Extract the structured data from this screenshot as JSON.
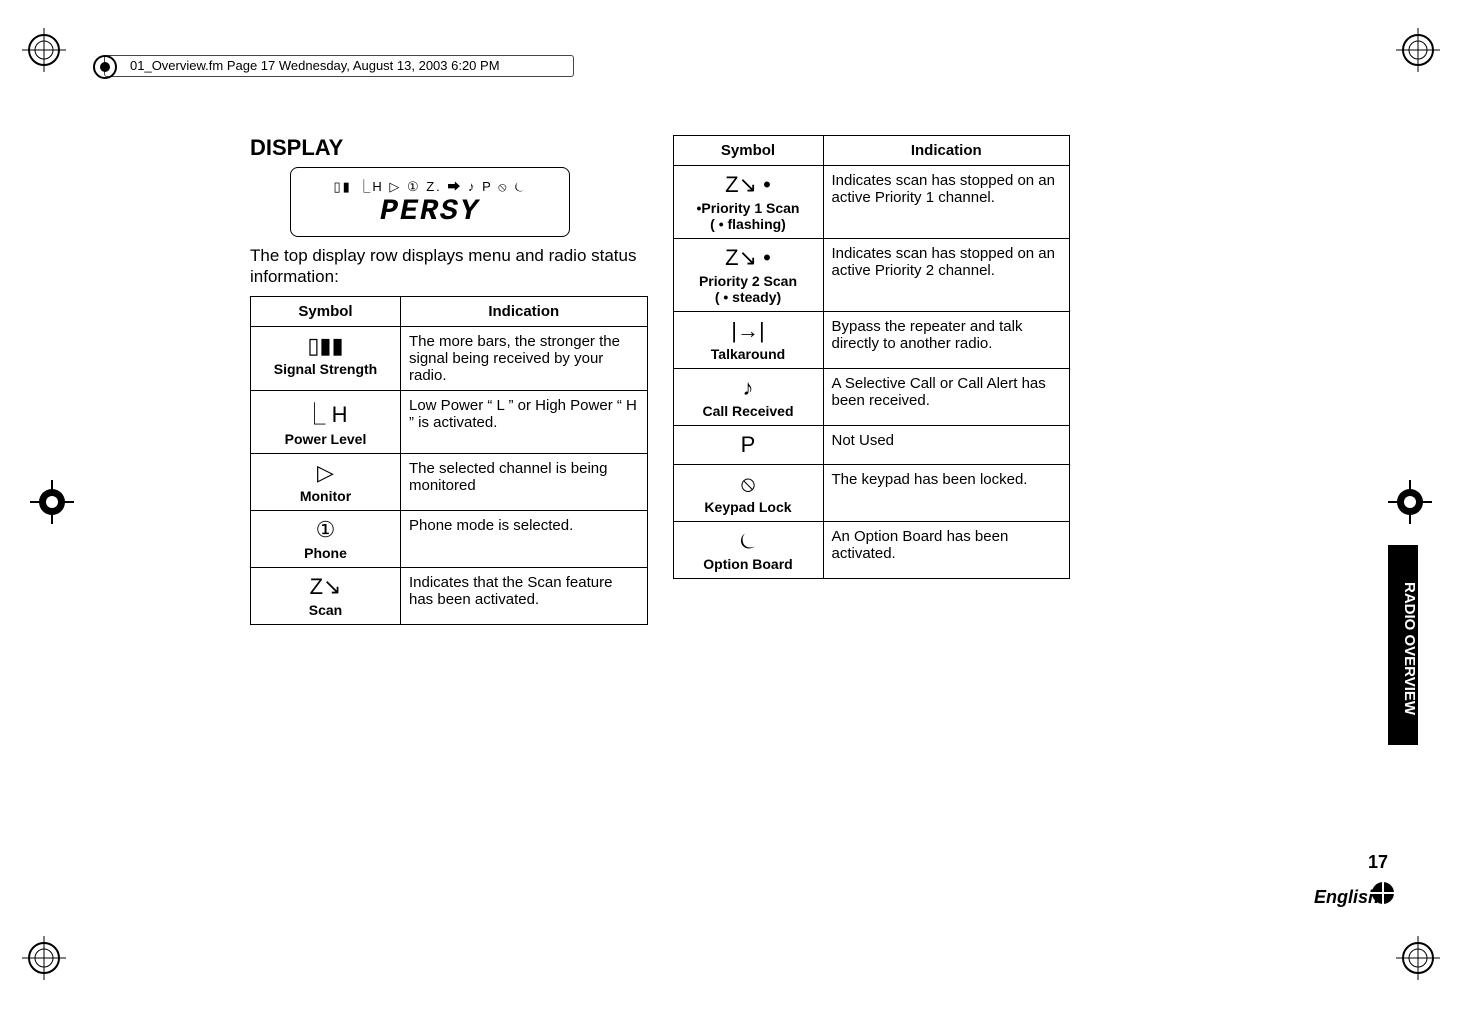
{
  "header": {
    "file_line": "01_Overview.fm  Page 17  Wednesday, August 13, 2003  6:20 PM"
  },
  "page": {
    "number": "17",
    "language": "English",
    "tab_section": "RADIO OVERVIEW"
  },
  "display": {
    "heading": "DISPLAY",
    "lcd_icons": "▯▮ ⎿H ▷ ① Z. ⮕ ♪ P ⦸ ⏾",
    "lcd_text": "PERSY",
    "intro": "The top display row displays menu and radio status information:"
  },
  "table_headers": {
    "symbol": "Symbol",
    "indication": "Indication"
  },
  "left_table": [
    {
      "icon": "▯▮▮",
      "label": "Signal Strength",
      "ind": "The more bars, the stronger the signal being received by your radio."
    },
    {
      "icon": "⎿ H",
      "label": "Power Level",
      "ind": "Low Power  “ L ” or High Power  “ H ” is activated."
    },
    {
      "icon": "▷",
      "label": "Monitor",
      "ind": "The selected channel is being monitored"
    },
    {
      "icon": "①",
      "label": "Phone",
      "ind": "Phone mode is selected."
    },
    {
      "icon": "Z↘",
      "label": "Scan",
      "ind": "Indicates that the Scan feature has been activated."
    }
  ],
  "right_table": [
    {
      "icon": "Z↘ •",
      "label": "•Priority 1 Scan\n( •  flashing)",
      "ind": "Indicates scan has stopped on an active  Priority 1 channel."
    },
    {
      "icon": "Z↘ •",
      "label": "Priority 2 Scan\n( •  steady)",
      "ind": "Indicates scan has stopped on an active Priority 2 channel."
    },
    {
      "icon": "|→|",
      "label": "Talkaround",
      "ind": "Bypass the repeater and talk directly to another radio."
    },
    {
      "icon": "♪",
      "label": "Call Received",
      "ind": "A Selective Call or Call Alert has been received."
    },
    {
      "icon": "P",
      "label": "",
      "ind": "Not Used"
    },
    {
      "icon": "⦸",
      "label": "Keypad Lock",
      "ind": "The keypad has been locked."
    },
    {
      "icon": "⏾",
      "label": "Option Board",
      "ind": "An Option Board has been activated."
    }
  ]
}
